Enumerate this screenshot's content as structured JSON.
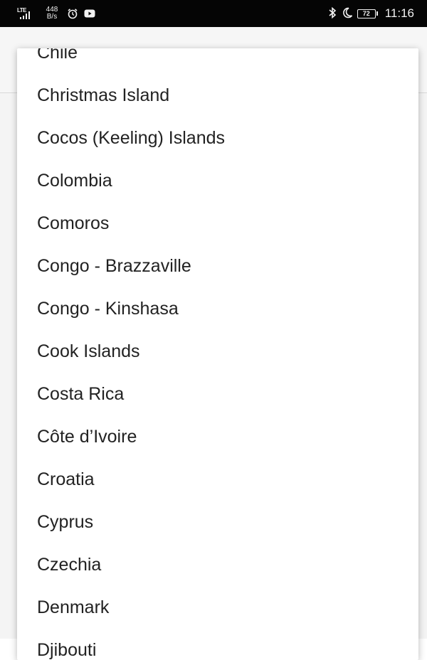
{
  "status_bar": {
    "network_type": "LTE",
    "data_speed_value": "448",
    "data_speed_unit": "B/s",
    "battery_level": "72",
    "time": "11:16"
  },
  "country_list": [
    "Chile",
    "Christmas Island",
    "Cocos (Keeling) Islands",
    "Colombia",
    "Comoros",
    "Congo - Brazzaville",
    "Congo - Kinshasa",
    "Cook Islands",
    "Costa Rica",
    "Côte d’Ivoire",
    "Croatia",
    "Cyprus",
    "Czechia",
    "Denmark",
    "Djibouti"
  ]
}
